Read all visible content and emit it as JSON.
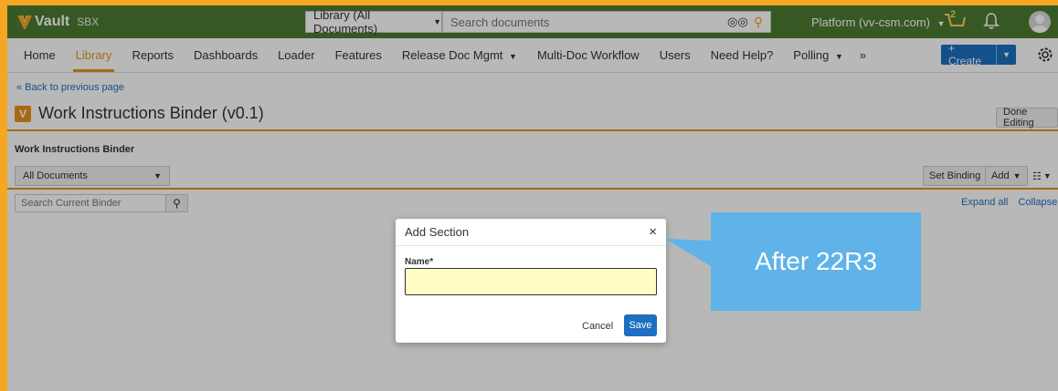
{
  "header": {
    "app_name": "Vault",
    "env": "SBX",
    "scope_label": "Library (All Documents)",
    "search_placeholder": "Search documents",
    "domain": "Platform (vv-csm.com)",
    "cart_count": "2",
    "brand_color": "#4b7a31"
  },
  "nav": {
    "items": [
      "Home",
      "Library",
      "Reports",
      "Dashboards",
      "Loader",
      "Features",
      "Release Doc Mgmt",
      "Multi-Doc Workflow",
      "Users",
      "Need Help?",
      "Polling"
    ],
    "active": "Library",
    "create_label": "+ Create"
  },
  "page": {
    "back_link": "« Back to previous page",
    "doc_icon_letter": "V",
    "title": "Work Instructions Binder (v0.1)",
    "done_label": "Done Editing",
    "section_title": "Work Instructions Binder",
    "filter_value": "All Documents",
    "set_binding_label": "Set Binding",
    "add_label": "Add",
    "binder_search_placeholder": "Search Current Binder",
    "expand_all": "Expand all",
    "collapse_all": "Collapse all"
  },
  "modal": {
    "title": "Add Section",
    "field_label": "Name*",
    "field_value": "",
    "cancel_label": "Cancel",
    "save_label": "Save"
  },
  "callout": {
    "text": "After 22R3",
    "color": "#5fb3e8"
  }
}
